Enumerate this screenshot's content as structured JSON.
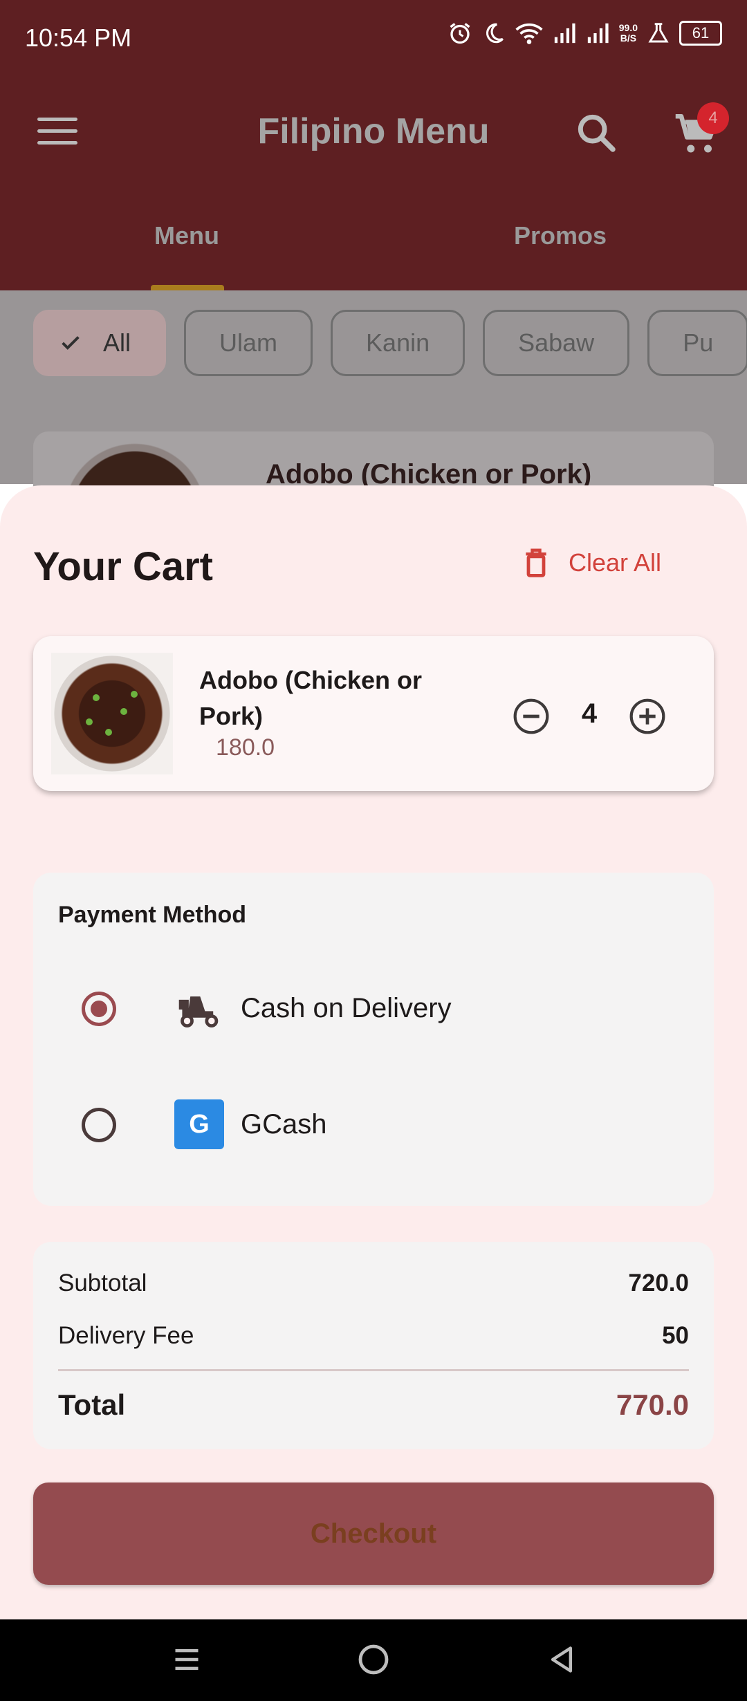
{
  "status_bar": {
    "time": "10:54 PM",
    "net_speed_value": "99.0",
    "net_speed_unit": "B/S",
    "battery": "61"
  },
  "app_bar": {
    "title": "Filipino Menu",
    "cart_count": "4",
    "tabs": [
      {
        "label": "Menu",
        "selected": true
      },
      {
        "label": "Promos",
        "selected": false
      }
    ]
  },
  "categories": {
    "chips": [
      {
        "label": "All",
        "selected": true
      },
      {
        "label": "Ulam",
        "selected": false
      },
      {
        "label": "Kanin",
        "selected": false
      },
      {
        "label": "Sabaw",
        "selected": false
      },
      {
        "label": "Pu",
        "selected": false
      }
    ]
  },
  "menu_preview": {
    "item_title": "Adobo (Chicken or Pork)"
  },
  "cart": {
    "title": "Your Cart",
    "clear_all_label": "Clear All",
    "items": [
      {
        "name": "Adobo (Chicken or Pork)",
        "price": "180.0",
        "quantity": "4"
      }
    ]
  },
  "payment": {
    "title": "Payment Method",
    "options": [
      {
        "label": "Cash on Delivery",
        "icon": "delivery-scooter-icon",
        "selected": true
      },
      {
        "label": "GCash",
        "icon": "gcash-icon",
        "icon_letter": "G",
        "selected": false
      }
    ]
  },
  "summary": {
    "subtotal_label": "Subtotal",
    "subtotal_value": "720.0",
    "delivery_fee_label": "Delivery Fee",
    "delivery_fee_value": "50",
    "total_label": "Total",
    "total_value": "770.0"
  },
  "checkout_label": "Checkout",
  "colors": {
    "app_bar": "#5e1f22",
    "sheet_background": "#fdecec",
    "accent": "#944b4f",
    "clear_all": "#d2423b",
    "total_value": "#8a4446",
    "gcash_blue": "#2b8ae3"
  }
}
